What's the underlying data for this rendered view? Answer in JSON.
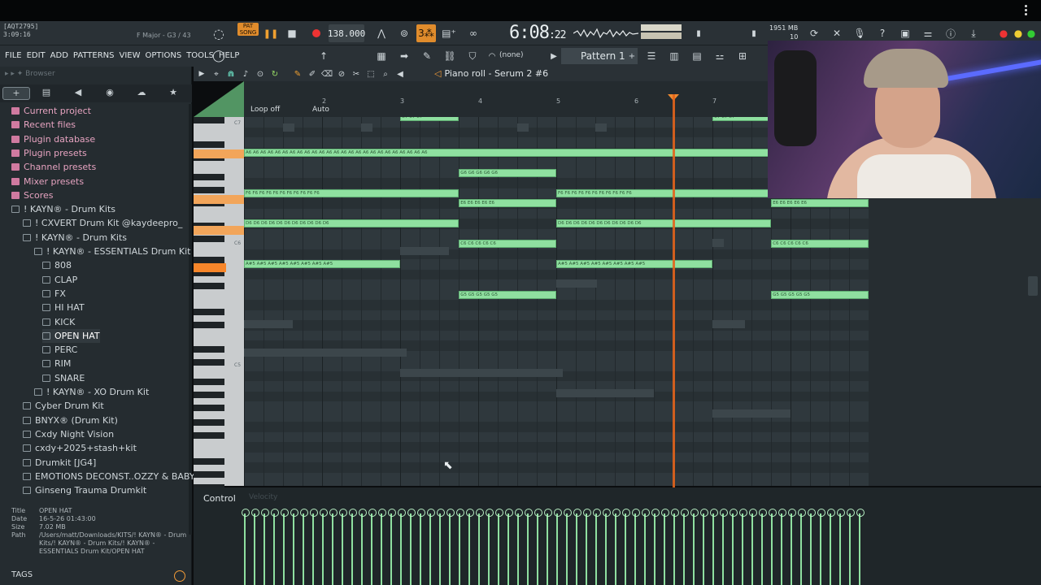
{
  "header": {
    "hint_line1": "[AQT2795]",
    "hint_line2": "3:09:16",
    "scale": "F Major - G3 / 43",
    "pat_label": "PAT SONG",
    "tempo": "138.000",
    "time_main": "6:08",
    "time_sub": ":22",
    "mem_line1": "1951 MB",
    "mem_line2": "10"
  },
  "menu": {
    "items": [
      "FILE",
      "EDIT",
      "ADD",
      "PATTERNS",
      "VIEW",
      "OPTIONS",
      "TOOLS",
      "HELP"
    ],
    "none_select": "(none)",
    "pattern": "Pattern 1"
  },
  "browser": {
    "title": "Browser",
    "tabs": [
      "+",
      "▤",
      "◀",
      "◉",
      "☁",
      "★"
    ],
    "tree": [
      {
        "label": "Current project",
        "type": "pink"
      },
      {
        "label": "Recent files",
        "type": "pink"
      },
      {
        "label": "Plugin database",
        "type": "pink"
      },
      {
        "label": "Plugin presets",
        "type": "pink"
      },
      {
        "label": "Channel presets",
        "type": "pink"
      },
      {
        "label": "Mixer presets",
        "type": "pink"
      },
      {
        "label": "Scores",
        "type": "pink"
      },
      {
        "label": "! KAYN® - Drum Kits",
        "type": "folder"
      },
      {
        "label": "! CXVERT Drum Kit @kaydeepro_",
        "type": "folder"
      },
      {
        "label": "! KAYN® - Drum Kits",
        "type": "folder"
      },
      {
        "label": "! KAYN® - ESSENTIALS Drum Kit",
        "type": "folder"
      },
      {
        "label": "808",
        "type": "folder"
      },
      {
        "label": "CLAP",
        "type": "folder"
      },
      {
        "label": "FX",
        "type": "folder"
      },
      {
        "label": "HI HAT",
        "type": "folder"
      },
      {
        "label": "KICK",
        "type": "folder"
      },
      {
        "label": "OPEN HAT",
        "type": "folder"
      },
      {
        "label": "PERC",
        "type": "folder"
      },
      {
        "label": "RIM",
        "type": "folder"
      },
      {
        "label": "SNARE",
        "type": "folder"
      },
      {
        "label": "! KAYN® - XO Drum Kit",
        "type": "folder"
      },
      {
        "label": "Cyber Drum Kit",
        "type": "folder"
      },
      {
        "label": "BNYX® (Drum Kit)",
        "type": "folder"
      },
      {
        "label": "Cxdy Night Vision",
        "type": "folder"
      },
      {
        "label": "cxdy+2025+stash+kit",
        "type": "folder"
      },
      {
        "label": "Drumkit [JG4]",
        "type": "folder"
      },
      {
        "label": "EMOTIONS DECONST..OZZY & BABYXPROD",
        "type": "folder"
      },
      {
        "label": "Ginseng Trauma Drumkit",
        "type": "folder"
      }
    ],
    "info": {
      "title_label": "Title",
      "title": "OPEN HAT",
      "date_label": "Date",
      "date": "16-5-26 01:43:00",
      "size_label": "Size",
      "size": "7.02 MB",
      "path_label": "Path",
      "path": "/Users/matt/Downloads/KITS/! KAYN® - Drum Kits/! KAYN® - Drum Kits/! KAYN® - ESSENTIALS Drum Kit/OPEN HAT"
    },
    "tags": "TAGS"
  },
  "piano_roll": {
    "title_prefix": "◁",
    "title": "Piano roll - Serum 2 #6",
    "loop": "Loop off",
    "auto": "Auto",
    "ruler_numbers": [
      "2",
      "3",
      "4",
      "5",
      "6",
      "7"
    ],
    "key_labels": [
      "C7",
      "C6",
      "C5"
    ],
    "notes": [
      {
        "label": "C7",
        "row": 0,
        "start": 0.25,
        "len": 0.094,
        "repeat": 3
      },
      {
        "label": "C7",
        "row": 0,
        "start": 0.75,
        "len": 0.094,
        "repeat": 3
      },
      {
        "label": "A6",
        "row": 3.5,
        "start": 0,
        "len": 0.84,
        "repeat": 25
      },
      {
        "label": "G6",
        "row": 5.5,
        "start": 0.344,
        "len": 0.156,
        "repeat": 5
      },
      {
        "label": "F6",
        "row": 7.5,
        "start": 0,
        "len": 0.344,
        "repeat": 11
      },
      {
        "label": "F6",
        "row": 7.5,
        "start": 0.5,
        "len": 0.344,
        "repeat": 11
      },
      {
        "label": "E6",
        "row": 8.5,
        "start": 0.344,
        "len": 0.156,
        "repeat": 5
      },
      {
        "label": "E6",
        "row": 8.5,
        "start": 0.844,
        "len": 0.156,
        "repeat": 5
      },
      {
        "label": "D6",
        "row": 10.5,
        "start": 0,
        "len": 0.344,
        "repeat": 11
      },
      {
        "label": "D6",
        "row": 10.5,
        "start": 0.5,
        "len": 0.344,
        "repeat": 11
      },
      {
        "label": "C6",
        "row": 12.5,
        "start": 0.344,
        "len": 0.156,
        "repeat": 5
      },
      {
        "label": "C6",
        "row": 12.5,
        "start": 0.844,
        "len": 0.156,
        "repeat": 5
      },
      {
        "label": "A#5",
        "row": 14.5,
        "start": 0,
        "len": 0.25,
        "repeat": 8
      },
      {
        "label": "A#5",
        "row": 14.5,
        "start": 0.5,
        "len": 0.25,
        "repeat": 8
      },
      {
        "label": "G5",
        "row": 17.5,
        "start": 0.344,
        "len": 0.156,
        "repeat": 5
      },
      {
        "label": "G5",
        "row": 17.5,
        "start": 0.844,
        "len": 0.156,
        "repeat": 5
      }
    ]
  },
  "control": {
    "label": "Control",
    "velocity": "Velocity",
    "bar_count": 32,
    "velocity_level": 0.94
  },
  "colors": {
    "note": "#8fe0a0",
    "playhead": "#e3641c",
    "accent": "#f09a38"
  }
}
